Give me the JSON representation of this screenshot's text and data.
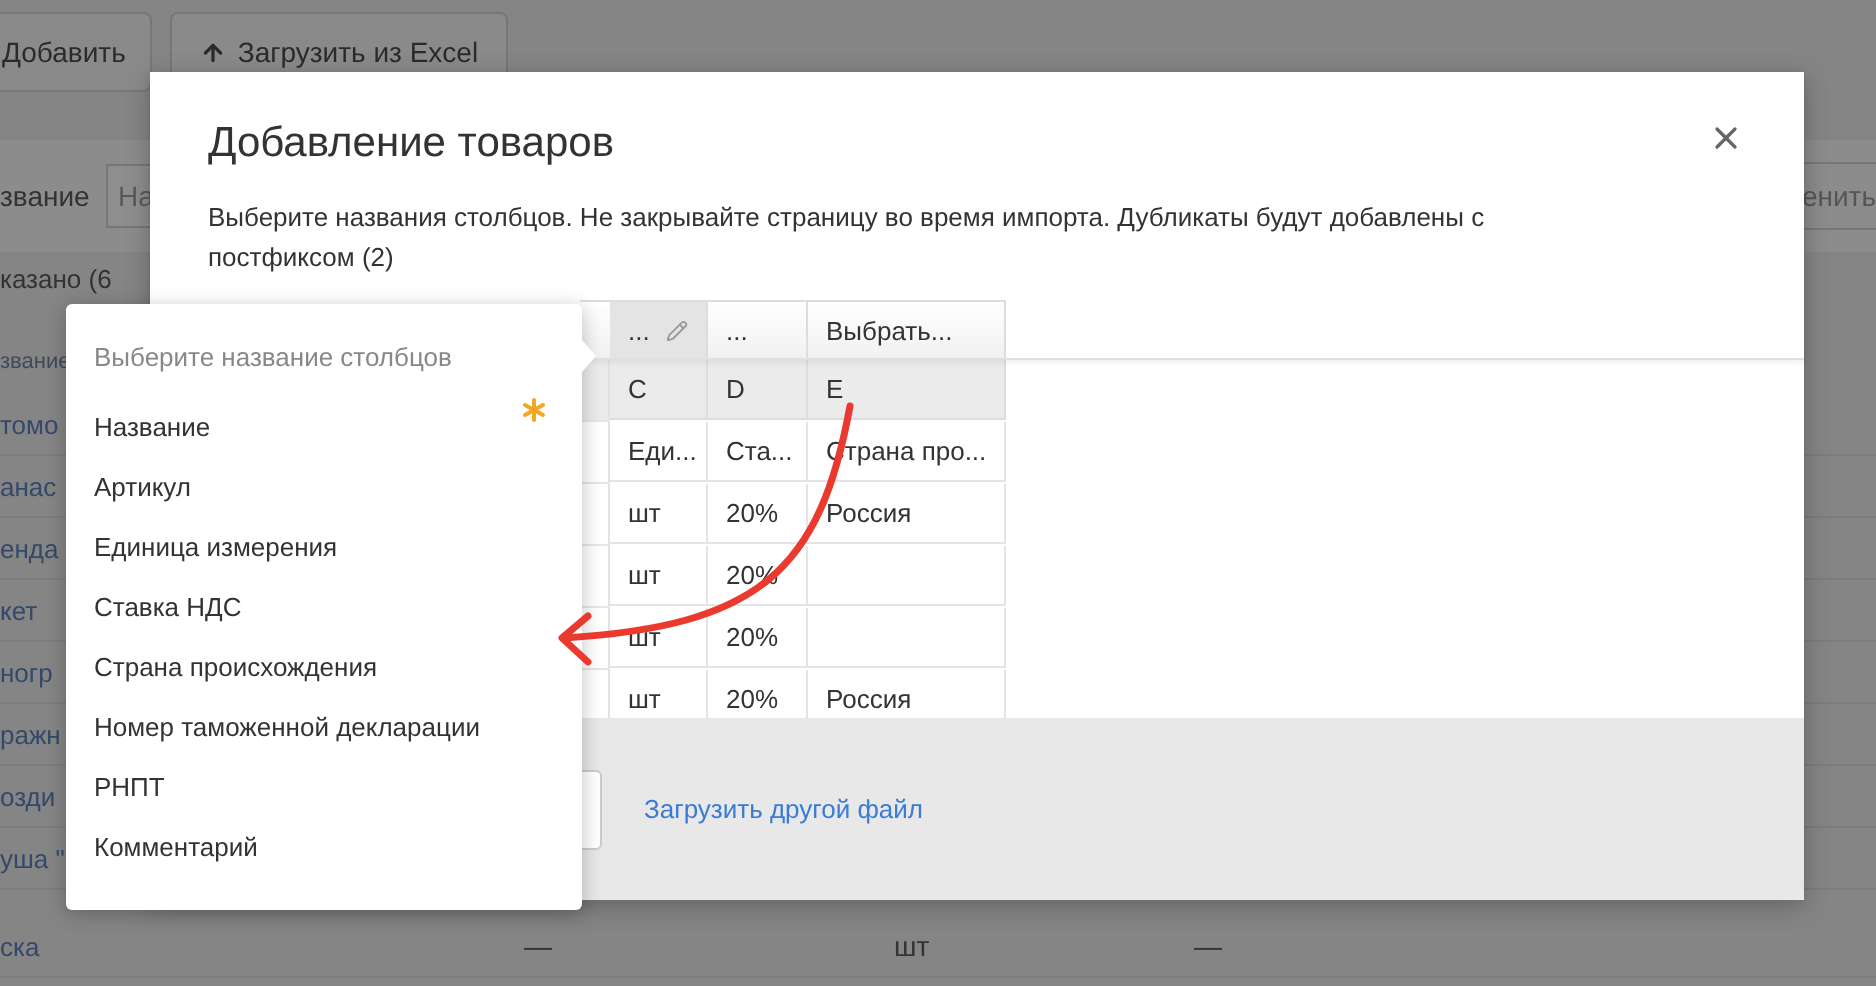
{
  "background": {
    "toolbar_buttons": [
      {
        "label": "Добавить",
        "kind": "plain"
      },
      {
        "label": "Загрузить из Excel",
        "kind": "upload"
      }
    ],
    "filter": {
      "label": "звание",
      "placeholder": "На",
      "apply_button": "енить"
    },
    "summary": "казано (6",
    "column_header": "звание",
    "rows": [
      {
        "name": "томо"
      },
      {
        "name": "анас"
      },
      {
        "name": "енда"
      },
      {
        "name": "кет"
      },
      {
        "name": "ногр"
      },
      {
        "name": "ражн"
      },
      {
        "name": "озди"
      },
      {
        "name": "уша \""
      },
      {
        "name": "ска",
        "column_2": "—",
        "column_3": "шт",
        "column_4": "—"
      }
    ]
  },
  "dialog": {
    "title": "Добавление товаров",
    "description": "Выберите названия столбцов. Не закрывайте страницу во время импорта. Дубликаты будут добавлены с постфиксом (2)",
    "columns": [
      {
        "label": "...",
        "selected": true,
        "editable": true
      },
      {
        "label": "...",
        "selected": false,
        "editable": false
      },
      {
        "label": "Выбрать...",
        "selected": false,
        "editable": false
      }
    ],
    "letters": [
      "C",
      "D",
      "E"
    ],
    "rows": [
      [
        "Еди...",
        "Ста...",
        "Страна про..."
      ],
      [
        "шт",
        "20%",
        "Россия"
      ],
      [
        "шт",
        "20%",
        null
      ],
      [
        "шт",
        "20%",
        null
      ],
      [
        "шт",
        "20%",
        "Россия"
      ]
    ],
    "link": "Загрузить другой файл"
  },
  "column_menu": {
    "title": "Выберите название столбцов",
    "items": [
      {
        "label": "Название",
        "required": true
      },
      {
        "label": "Артикул",
        "required": false
      },
      {
        "label": "Единица измерения",
        "required": false
      },
      {
        "label": "Ставка НДС",
        "required": false
      },
      {
        "label": "Страна происхождения",
        "required": false
      },
      {
        "label": "Номер таможенной декларации",
        "required": false
      },
      {
        "label": "РНПТ",
        "required": false
      },
      {
        "label": "Комментарий",
        "required": false
      }
    ]
  }
}
